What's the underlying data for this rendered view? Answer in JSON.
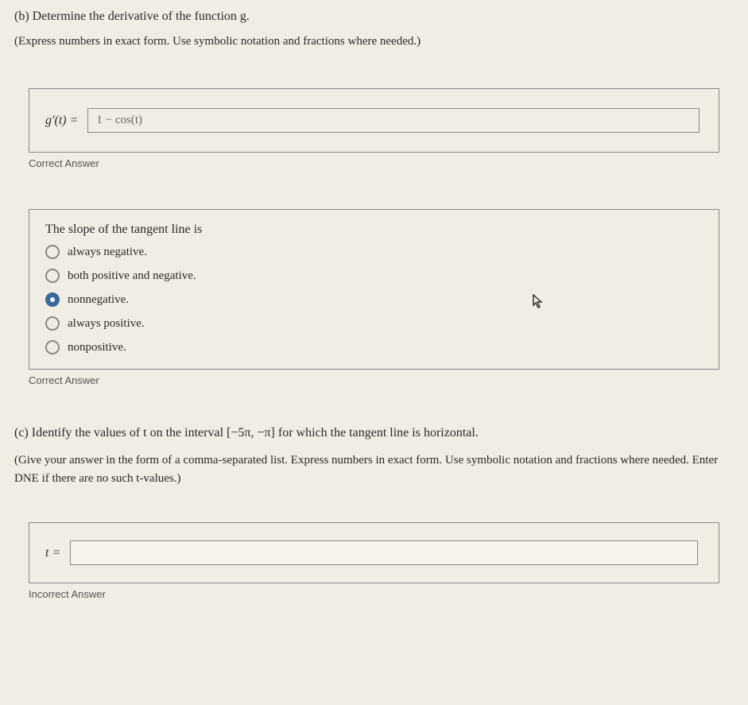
{
  "partB": {
    "prompt": "(b) Determine the derivative of the function g.",
    "instruction": "(Express numbers in exact form. Use symbolic notation and fractions where needed.)",
    "label": "g′(t) =",
    "input_value": "1 − cos(t)",
    "feedback": "Correct Answer"
  },
  "radioSection": {
    "prompt": "The slope of the tangent line is",
    "options": [
      {
        "label": "always negative.",
        "selected": false
      },
      {
        "label": "both positive and negative.",
        "selected": false
      },
      {
        "label": "nonnegative.",
        "selected": true
      },
      {
        "label": "always positive.",
        "selected": false
      },
      {
        "label": "nonpositive.",
        "selected": false
      }
    ],
    "feedback": "Correct Answer"
  },
  "partC": {
    "prompt": "(c) Identify the values of t on the interval [−5π, −π] for which the tangent line is horizontal.",
    "instruction": "(Give your answer in the form of a comma-separated list. Express numbers in exact form. Use symbolic notation and fractions where needed. Enter DNE if there are no such t-values.)",
    "label": "t =",
    "input_value": "",
    "feedback": "Incorrect Answer"
  }
}
